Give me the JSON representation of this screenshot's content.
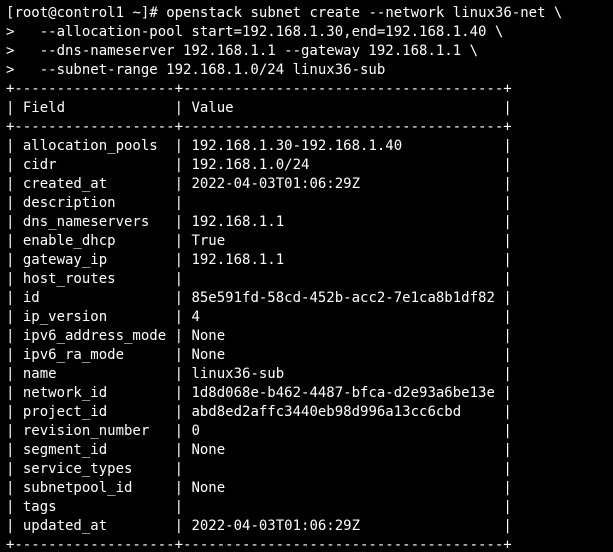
{
  "prompt": {
    "user": "root",
    "host": "control1",
    "path": "~",
    "symbol": "#"
  },
  "command": {
    "lines": [
      "openstack subnet create --network linux36-net \\",
      "  --allocation-pool start=192.168.1.30,end=192.168.1.40 \\",
      "  --dns-nameserver 192.168.1.1 --gateway 192.168.1.1 \\",
      "  --subnet-range 192.168.1.0/24 linux36-sub"
    ]
  },
  "table": {
    "headers": {
      "field": "Field",
      "value": "Value"
    },
    "rows": [
      {
        "field": "allocation_pools",
        "value": "192.168.1.30-192.168.1.40"
      },
      {
        "field": "cidr",
        "value": "192.168.1.0/24"
      },
      {
        "field": "created_at",
        "value": "2022-04-03T01:06:29Z"
      },
      {
        "field": "description",
        "value": ""
      },
      {
        "field": "dns_nameservers",
        "value": "192.168.1.1"
      },
      {
        "field": "enable_dhcp",
        "value": "True"
      },
      {
        "field": "gateway_ip",
        "value": "192.168.1.1"
      },
      {
        "field": "host_routes",
        "value": ""
      },
      {
        "field": "id",
        "value": "85e591fd-58cd-452b-acc2-7e1ca8b1df82"
      },
      {
        "field": "ip_version",
        "value": "4"
      },
      {
        "field": "ipv6_address_mode",
        "value": "None"
      },
      {
        "field": "ipv6_ra_mode",
        "value": "None"
      },
      {
        "field": "name",
        "value": "linux36-sub"
      },
      {
        "field": "network_id",
        "value": "1d8d068e-b462-4487-bfca-d2e93a6be13e"
      },
      {
        "field": "project_id",
        "value": "abd8ed2affc3440eb98d996a13cc6cbd"
      },
      {
        "field": "revision_number",
        "value": "0"
      },
      {
        "field": "segment_id",
        "value": "None"
      },
      {
        "field": "service_types",
        "value": ""
      },
      {
        "field": "subnetpool_id",
        "value": "None"
      },
      {
        "field": "tags",
        "value": ""
      },
      {
        "field": "updated_at",
        "value": "2022-04-03T01:06:29Z"
      }
    ]
  },
  "layout": {
    "col1_width": 19,
    "col2_width": 38,
    "cont_prefix": "> "
  }
}
